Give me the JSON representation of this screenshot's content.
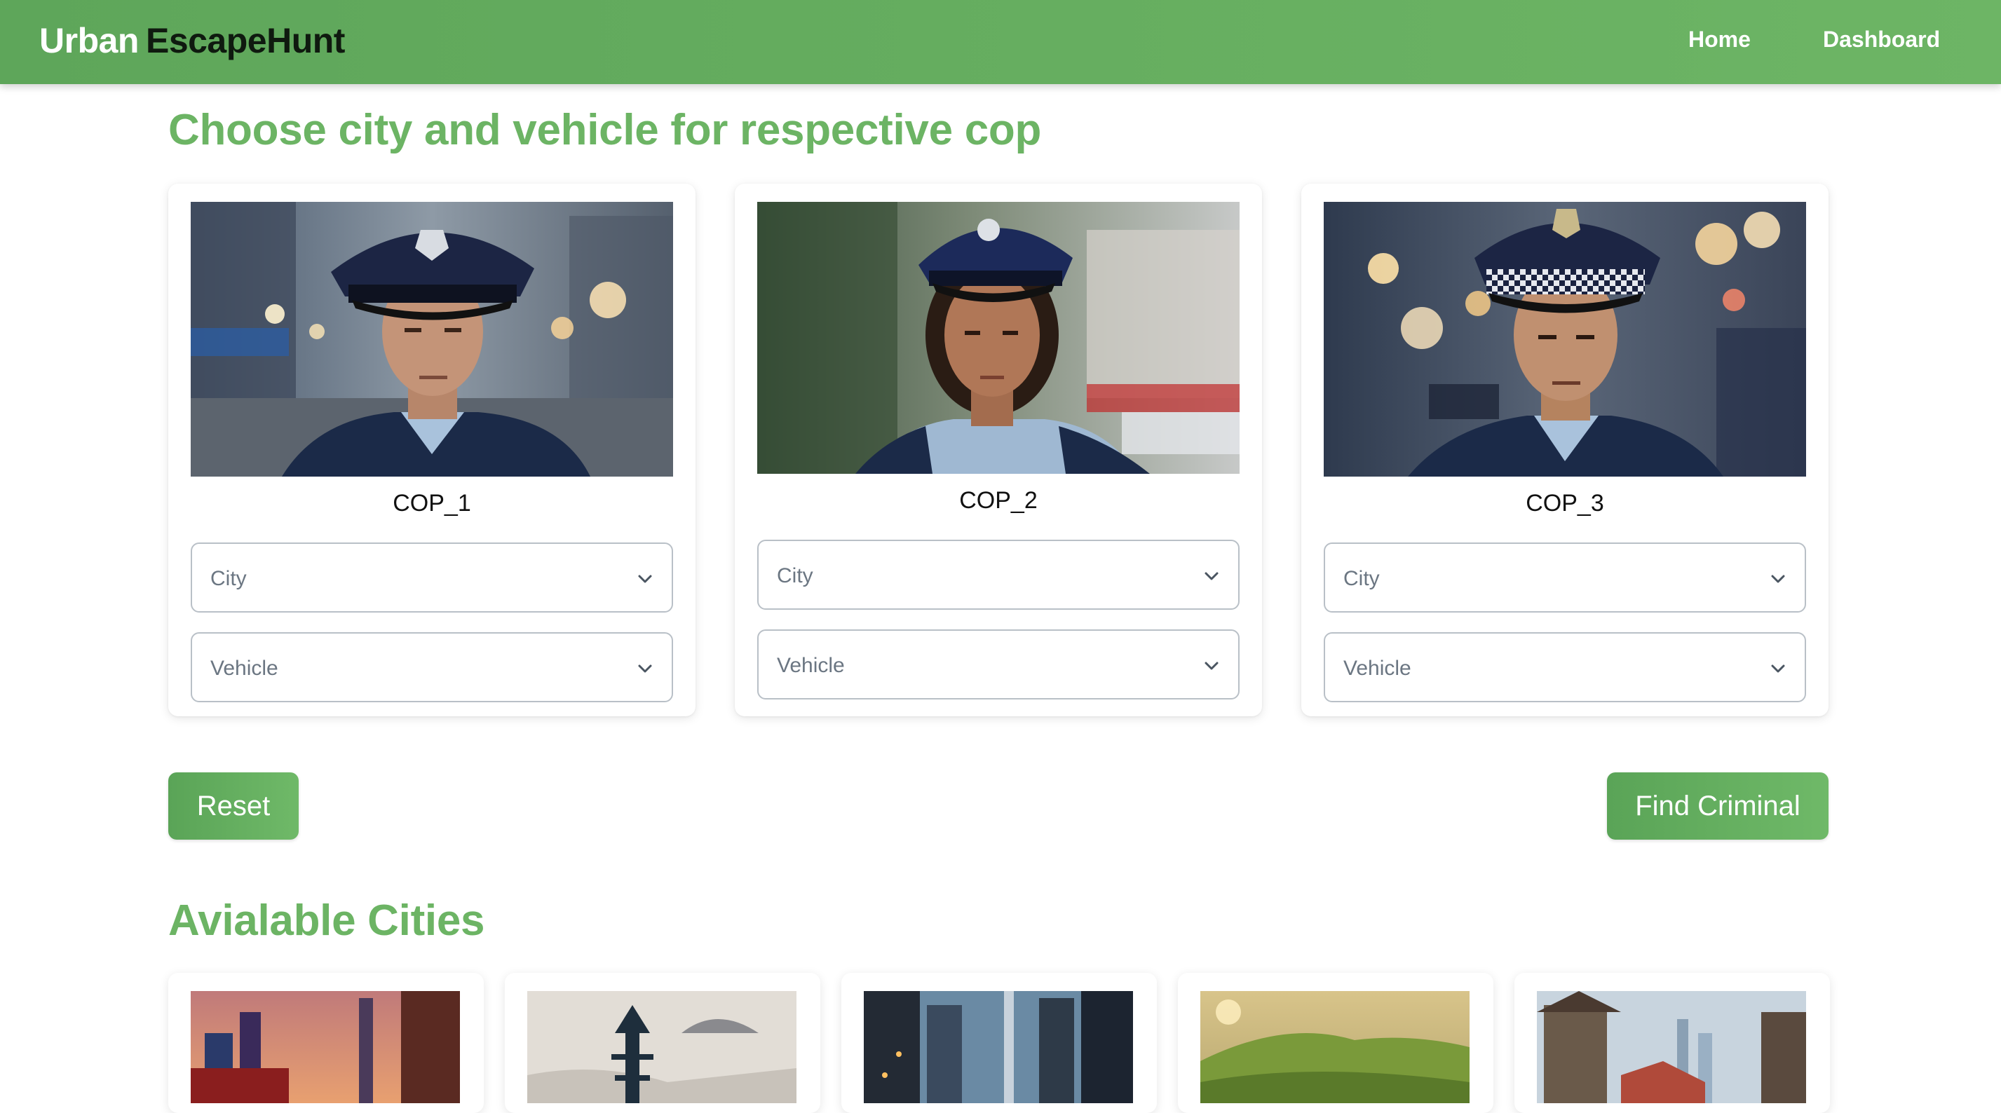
{
  "navbar": {
    "brand_part1": "Urban",
    "brand_part2": "EscapeHunt",
    "links": [
      {
        "label": "Home"
      },
      {
        "label": "Dashboard"
      }
    ],
    "colors": {
      "bar": "#5ea65a",
      "link": "#ffffff"
    }
  },
  "cop_section": {
    "title": "Choose city and vehicle for respective cop"
  },
  "cops": [
    {
      "name": "COP_1",
      "city_placeholder": "City",
      "vehicle_placeholder": "Vehicle"
    },
    {
      "name": "COP_2",
      "city_placeholder": "City",
      "vehicle_placeholder": "Vehicle"
    },
    {
      "name": "COP_3",
      "city_placeholder": "City",
      "vehicle_placeholder": "Vehicle"
    }
  ],
  "actions": {
    "reset_label": "Reset",
    "find_label": "Find Criminal"
  },
  "cities_section": {
    "title": "Avialable Cities"
  },
  "theme": {
    "accent": "#6cb464",
    "button": "#5aa457"
  }
}
